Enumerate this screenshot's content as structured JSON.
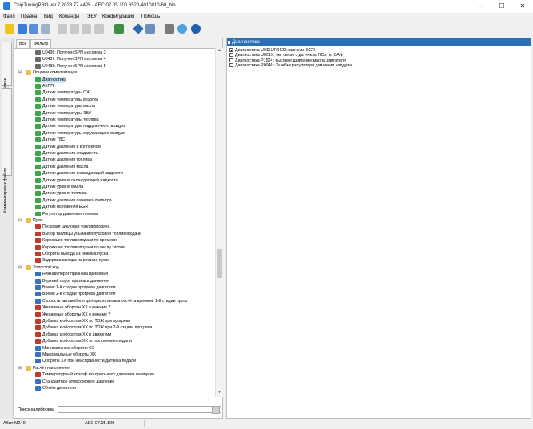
{
  "window": {
    "title": "ChipTuningPRO ver.7.2023.77.4425 - AEC 07.05.100 6520-4010010-60_bin",
    "minimize": "—",
    "maximize": "☐",
    "close": "✕"
  },
  "menu": [
    "Файл",
    "Правка",
    "Вид",
    "Команды",
    "ЭБУ",
    "Конфигурация",
    "Помощь"
  ],
  "side_tabs": [
    "Меню калибровок",
    "Комментарии к файлу"
  ],
  "left_tabs": [
    "Все",
    "Фильтр"
  ],
  "tree": [
    {
      "label": "U0436: Получен SPN из списка 3",
      "level": 3,
      "icon": "spn"
    },
    {
      "label": "U0437: Получен SPN из списка 4",
      "level": 3,
      "icon": "spn"
    },
    {
      "label": "U0438: Получен SPN из списка 5",
      "level": 3,
      "icon": "spn"
    },
    {
      "label": "Опции и комплектация",
      "level": 1,
      "icon": "folder",
      "expander": "⊟"
    },
    {
      "label": "Диагностика",
      "level": 2,
      "icon": "check",
      "selected": true
    },
    {
      "label": "АКПП",
      "level": 2,
      "icon": "check"
    },
    {
      "label": "Датчик температуры ОЖ",
      "level": 2,
      "icon": "check"
    },
    {
      "label": "Датчик температуры воздуха",
      "level": 2,
      "icon": "check"
    },
    {
      "label": "Датчик температуры масла",
      "level": 2,
      "icon": "check"
    },
    {
      "label": "Датчик температуры ЭБУ",
      "level": 2,
      "icon": "check"
    },
    {
      "label": "Датчик температуры топлива",
      "level": 2,
      "icon": "check"
    },
    {
      "label": "Датчик температуры наддувочного воздуха",
      "level": 2,
      "icon": "check"
    },
    {
      "label": "Датчик температуры окружающего воздуха",
      "level": 2,
      "icon": "check"
    },
    {
      "label": "Датчик ТВС",
      "level": 2,
      "icon": "check"
    },
    {
      "label": "Датчик давления в коллекторе",
      "level": 2,
      "icon": "check"
    },
    {
      "label": "Датчик давления хладагента",
      "level": 2,
      "icon": "check"
    },
    {
      "label": "Датчик давления топлива",
      "level": 2,
      "icon": "check"
    },
    {
      "label": "Датчик давления масла",
      "level": 2,
      "icon": "check"
    },
    {
      "label": "Датчик давления охлаждающей жидкости",
      "level": 2,
      "icon": "check"
    },
    {
      "label": "Датчик уровня охлаждающей жидкости",
      "level": 2,
      "icon": "check"
    },
    {
      "label": "Датчик уровня масла",
      "level": 2,
      "icon": "check"
    },
    {
      "label": "Датчик уровня топлива",
      "level": 2,
      "icon": "check"
    },
    {
      "label": "Датчик давления сажевого фильтра",
      "level": 2,
      "icon": "check"
    },
    {
      "label": "Датчик положения EGR",
      "level": 2,
      "icon": "check"
    },
    {
      "label": "Регулятор давления топлива",
      "level": 2,
      "icon": "check"
    },
    {
      "label": "Пуск",
      "level": 1,
      "icon": "folder",
      "expander": "⊟"
    },
    {
      "label": "Пусковая цикловая топливоподача",
      "level": 2,
      "icon": "curve"
    },
    {
      "label": "Выбор таблицы убывания пусковой топливоподачи",
      "level": 2,
      "icon": "curve"
    },
    {
      "label": "Коррекция топливоподачи по времени",
      "level": 2,
      "icon": "curve"
    },
    {
      "label": "Коррекция топливоподачи по числу тактов",
      "level": 2,
      "icon": "curve"
    },
    {
      "label": "Обороты выхода из режима пуска",
      "level": 2,
      "icon": "curve"
    },
    {
      "label": "Задержка выхода из режима пуска",
      "level": 2,
      "icon": "curve"
    },
    {
      "label": "Холостой ход",
      "level": 1,
      "icon": "folder",
      "expander": "⊟"
    },
    {
      "label": "Нижний порог признака движения",
      "level": 2,
      "icon": "num"
    },
    {
      "label": "Верхний порог признака движения",
      "level": 2,
      "icon": "num"
    },
    {
      "label": "Время 1-й стадии прогрева двигателя",
      "level": 2,
      "icon": "num"
    },
    {
      "label": "Время 2-й стадии прогрева двигателя",
      "level": 2,
      "icon": "num"
    },
    {
      "label": "Скорость автомобиля для приостановки отсчёта времени 1-й стадии прогр",
      "level": 2,
      "icon": "num"
    },
    {
      "label": "Желаемые обороты ХХ в режиме ?",
      "level": 2,
      "icon": "curve"
    },
    {
      "label": "Желаемые обороты ХХ в режиме ?",
      "level": 2,
      "icon": "curve"
    },
    {
      "label": "Добавка к оборотам ХХ по ТОЖ при прогреве",
      "level": 2,
      "icon": "curve"
    },
    {
      "label": "Добавка к оборотам ХХ по ТОЖ при 2-й стадии прогрева",
      "level": 2,
      "icon": "curve"
    },
    {
      "label": "Добавка к оборотам ХХ в движении",
      "level": 2,
      "icon": "curve"
    },
    {
      "label": "Добавка к оборотам ХХ по положению педали",
      "level": 2,
      "icon": "curve"
    },
    {
      "label": "Минимальные обороты ХХ",
      "level": 2,
      "icon": "num"
    },
    {
      "label": "Максимальные обороты ХХ",
      "level": 2,
      "icon": "num"
    },
    {
      "label": "Обороты ХХ при неисправности датчика педали",
      "level": 2,
      "icon": "num"
    },
    {
      "label": "Расчёт наполнения",
      "level": 1,
      "icon": "folder",
      "expander": "⊟"
    },
    {
      "label": "Температурный коэфф. контрольного давления на впуске",
      "level": 2,
      "icon": "curve"
    },
    {
      "label": "Стандартное атмосферное давление",
      "level": 2,
      "icon": "num"
    },
    {
      "label": "Объём двигателя",
      "level": 2,
      "icon": "num"
    }
  ],
  "search": {
    "label": "Поиск калибровки",
    "value": ""
  },
  "diagnostics": {
    "header": "Диагностика",
    "items": [
      {
        "label": "Диагностика U0113/P0420: система SCR",
        "checked": true
      },
      {
        "label": "Диагностика U0019: нет связи с датчиком NOx по CAN",
        "checked": false
      },
      {
        "label": "Диагностика P1524: высокое давление масла двигателя",
        "checked": false
      },
      {
        "label": "Диагностика P0046: Ошибка регулятора давления наддува",
        "checked": false
      }
    ]
  },
  "status": {
    "left": "Абит М240",
    "middle": "AEC 07.05.100"
  },
  "colors": {
    "header_blue": "#2d6fb7",
    "selection": "#cce4f7",
    "folder": "#e8c34a",
    "check_icon": "#3aa84a",
    "curve_icon": "#c0392b",
    "num_icon": "#3b6fc0"
  }
}
